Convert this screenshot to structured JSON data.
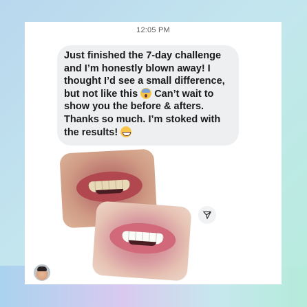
{
  "chat": {
    "timestamp": "12:05 PM",
    "message": {
      "text_part1": "Just finished the 7-day challenge\nand I’m honestly blown away! I\nthought I’d see a small difference,\nbut not like this ",
      "emoji1": "screaming-face-emoji",
      "text_part2": " Can’t wait to\nshow you the before & afters.\nThanks so much. I’m stoked with\nthe results! ",
      "emoji2": "grinning-face-emoji"
    },
    "attachments": [
      {
        "label": "before-smile-photo"
      },
      {
        "label": "after-smile-photo"
      }
    ],
    "icons": {
      "share": "share-icon",
      "avatar": "sender-avatar"
    }
  },
  "colors": {
    "bubble": "#eeeff1",
    "text": "#1a1a1a",
    "timestamp": "#5b5b5b",
    "background_start": "#b9d7ee",
    "background_end": "#b7ecdc"
  }
}
